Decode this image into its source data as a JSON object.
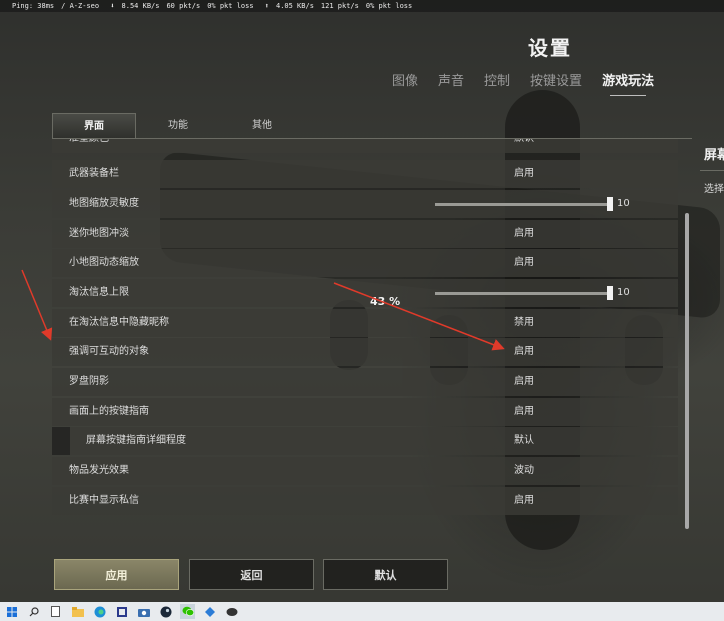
{
  "net_status": {
    "ping": "Ping: 38ms",
    "server": "/ A-Z-seo",
    "down_rate": "8.54 KB/s",
    "down_pkts": "60 pkt/s",
    "down_loss": "0% pkt loss",
    "up_rate": "4.05 KB/s",
    "up_pkts": "121 pkt/s",
    "up_loss": "0% pkt loss"
  },
  "header": {
    "title": "设置",
    "tabs": [
      {
        "label": "图像"
      },
      {
        "label": "声音"
      },
      {
        "label": "控制"
      },
      {
        "label": "按键设置"
      },
      {
        "label": "游戏玩法",
        "active": true
      }
    ]
  },
  "sub_tabs": [
    {
      "label": "界面",
      "active": true
    },
    {
      "label": "功能"
    },
    {
      "label": "其他"
    }
  ],
  "settings": [
    {
      "label": "准星颜色",
      "value": "默认"
    },
    {
      "label": "武器装备栏",
      "value": "启用"
    },
    {
      "label": "地图缩放灵敏度",
      "slider": 1.0,
      "value": "10"
    },
    {
      "label": "迷你地图冲淡",
      "value": "启用"
    },
    {
      "label": "小地图动态缩放",
      "value": "启用"
    },
    {
      "label": "淘汰信息上限",
      "slider": 1.0,
      "value": "10"
    },
    {
      "label": "在淘汰信息中隐藏昵称",
      "value": "禁用"
    },
    {
      "label": "强调可互动的对象",
      "value": "启用"
    },
    {
      "label": "罗盘阴影",
      "value": "启用"
    },
    {
      "label": "画面上的按键指南",
      "value": "启用"
    },
    {
      "label": "屏幕按键指南详细程度",
      "value": "默认",
      "indent": true
    },
    {
      "label": "物品发光效果",
      "value": "波动"
    },
    {
      "label": "比赛中显示私信",
      "value": "启用"
    }
  ],
  "side_panel": {
    "title": "屏幕",
    "text": "选择"
  },
  "annotation": {
    "percent": "43 %"
  },
  "buttons": {
    "apply": "应用",
    "back": "返回",
    "default": "默认"
  },
  "colors": {
    "row_bg": "#3a3a36",
    "accent_button": "#8a8668",
    "arrow": "#e03a2a",
    "taskbar": "#e8ebee"
  },
  "taskbar_icons": [
    "windows-icon",
    "search-icon",
    "file-icon",
    "folder-icon",
    "edge-icon",
    "app-icon",
    "camera-icon",
    "steam-icon",
    "wechat-icon",
    "game-icon",
    "chat-icon"
  ]
}
